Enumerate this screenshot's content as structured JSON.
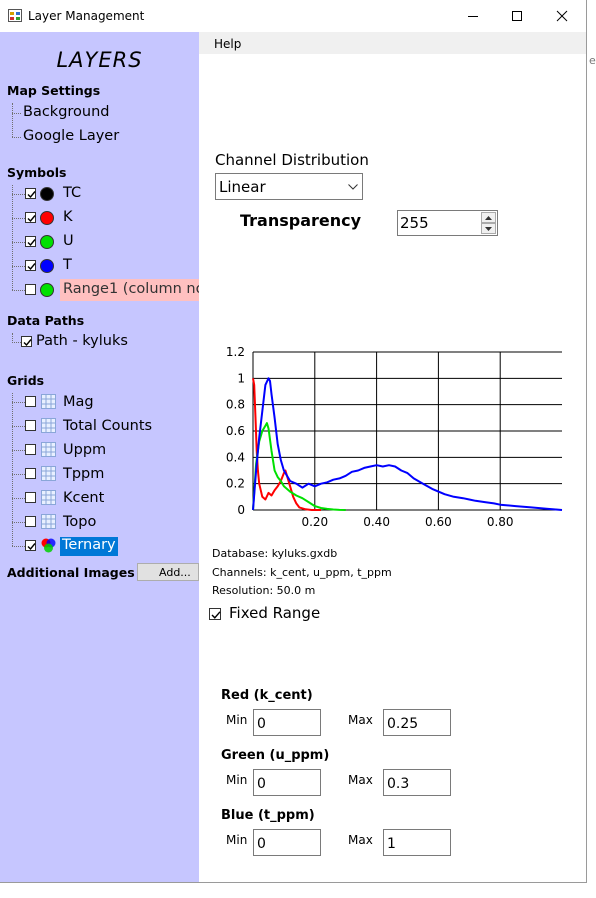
{
  "window": {
    "title": "Layer Management"
  },
  "menu": {
    "help": "Help"
  },
  "sidebar": {
    "title": "LAYERS",
    "map_settings": {
      "label": "Map Settings",
      "items": [
        "Background",
        "Google Layer"
      ]
    },
    "symbols": {
      "label": "Symbols",
      "items": [
        {
          "label": "TC",
          "checked": true,
          "color": "#000000"
        },
        {
          "label": "K",
          "checked": true,
          "color": "#ff0000"
        },
        {
          "label": "U",
          "checked": true,
          "color": "#00e000"
        },
        {
          "label": "T",
          "checked": true,
          "color": "#0000ff"
        },
        {
          "label": "Range1 (column no",
          "checked": false,
          "color": "#00e000",
          "highlight": "#ffc0c0"
        }
      ]
    },
    "data_paths": {
      "label": "Data Paths",
      "items": [
        {
          "label": "Path - kyluks",
          "checked": true
        }
      ]
    },
    "grids": {
      "label": "Grids",
      "items": [
        {
          "label": "Mag",
          "checked": false
        },
        {
          "label": "Total Counts",
          "checked": false
        },
        {
          "label": "Uppm",
          "checked": false
        },
        {
          "label": "Tppm",
          "checked": false
        },
        {
          "label": "Kcent",
          "checked": false
        },
        {
          "label": "Topo",
          "checked": false
        },
        {
          "label": "Ternary",
          "checked": true,
          "selected": true
        }
      ]
    },
    "additional_images": {
      "label": "Additional Images",
      "button": "Add..."
    }
  },
  "panel": {
    "channel_distribution_label": "Channel Distribution",
    "channel_distribution_value": "Linear",
    "transparency_label": "Transparency",
    "transparency_value": "255",
    "info": {
      "database": "Database: kyluks.gxdb",
      "channels": "Channels: k_cent, u_ppm, t_ppm",
      "resolution": "Resolution: 50.0 m"
    },
    "fixed_range": {
      "label": "Fixed Range",
      "checked": true
    },
    "ranges": [
      {
        "title": "Red (k_cent)",
        "min_label": "Min",
        "min": "0",
        "max_label": "Max",
        "max": "0.25"
      },
      {
        "title": "Green (u_ppm)",
        "min_label": "Min",
        "min": "0",
        "max_label": "Max",
        "max": "0.3"
      },
      {
        "title": "Blue (t_ppm)",
        "min_label": "Min",
        "min": "0",
        "max_label": "Max",
        "max": "1"
      }
    ]
  },
  "chart_data": {
    "type": "line",
    "title": "",
    "xlabel": "",
    "ylabel": "",
    "xlim": [
      0,
      1
    ],
    "ylim": [
      0,
      1.2
    ],
    "x_ticks": [
      "0.20",
      "0.40",
      "0.60",
      "0.80"
    ],
    "y_ticks": [
      "0",
      "0.2",
      "0.4",
      "0.6",
      "0.8",
      "1",
      "1.2"
    ],
    "grid": true,
    "series": [
      {
        "color": "#ff0000",
        "x": [
          0.0,
          0.004,
          0.008,
          0.012,
          0.016,
          0.02,
          0.03,
          0.04,
          0.05,
          0.06,
          0.07,
          0.08,
          0.09,
          0.1,
          0.105,
          0.11,
          0.12,
          0.13,
          0.14,
          0.15,
          0.17,
          0.19,
          0.2,
          0.22
        ],
        "y": [
          1.0,
          0.95,
          0.7,
          0.45,
          0.3,
          0.2,
          0.1,
          0.08,
          0.13,
          0.11,
          0.15,
          0.18,
          0.22,
          0.28,
          0.3,
          0.26,
          0.18,
          0.1,
          0.05,
          0.02,
          0.005,
          0.0,
          0.0,
          0.0
        ]
      },
      {
        "color": "#00e000",
        "x": [
          0.0,
          0.01,
          0.02,
          0.03,
          0.04,
          0.045,
          0.05,
          0.06,
          0.07,
          0.08,
          0.09,
          0.1,
          0.12,
          0.14,
          0.16,
          0.18,
          0.2,
          0.22,
          0.24,
          0.26,
          0.28,
          0.3
        ],
        "y": [
          0.0,
          0.35,
          0.52,
          0.6,
          0.64,
          0.66,
          0.62,
          0.45,
          0.3,
          0.25,
          0.22,
          0.18,
          0.14,
          0.11,
          0.09,
          0.06,
          0.03,
          0.015,
          0.008,
          0.004,
          0.001,
          0.0
        ]
      },
      {
        "color": "#0000ff",
        "x": [
          0.0,
          0.01,
          0.02,
          0.03,
          0.04,
          0.05,
          0.055,
          0.06,
          0.07,
          0.08,
          0.09,
          0.1,
          0.12,
          0.14,
          0.16,
          0.18,
          0.2,
          0.22,
          0.24,
          0.26,
          0.28,
          0.3,
          0.32,
          0.34,
          0.36,
          0.38,
          0.4,
          0.42,
          0.44,
          0.46,
          0.48,
          0.5,
          0.52,
          0.55,
          0.58,
          0.6,
          0.62,
          0.65,
          0.68,
          0.7,
          0.72,
          0.75,
          0.78,
          0.8,
          0.85,
          0.9,
          0.95,
          1.0
        ],
        "y": [
          0.0,
          0.3,
          0.55,
          0.75,
          0.95,
          1.0,
          0.98,
          0.88,
          0.7,
          0.5,
          0.38,
          0.3,
          0.22,
          0.2,
          0.17,
          0.2,
          0.18,
          0.2,
          0.21,
          0.23,
          0.24,
          0.26,
          0.29,
          0.3,
          0.32,
          0.33,
          0.34,
          0.33,
          0.34,
          0.33,
          0.3,
          0.28,
          0.24,
          0.2,
          0.16,
          0.14,
          0.12,
          0.1,
          0.09,
          0.08,
          0.07,
          0.06,
          0.05,
          0.04,
          0.03,
          0.02,
          0.01,
          0.0
        ]
      }
    ]
  }
}
